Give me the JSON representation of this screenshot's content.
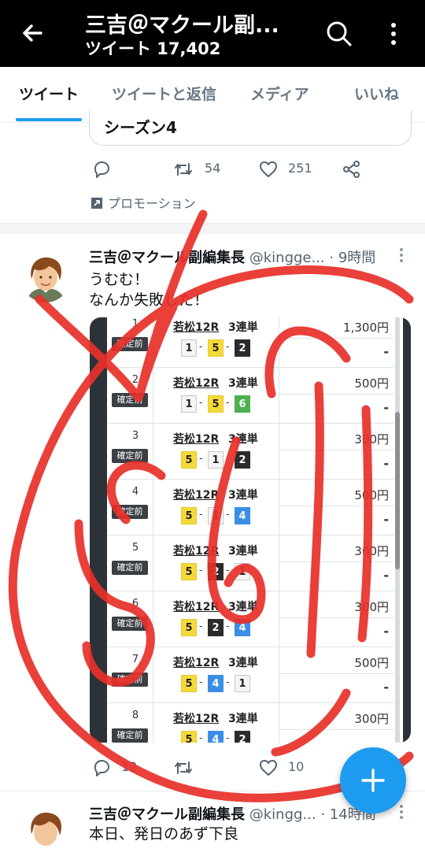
{
  "header": {
    "title": "三吉＠マクール副...",
    "subtitle": "ツイート 17,402"
  },
  "tabs": [
    {
      "label": "ツイート",
      "active": true
    },
    {
      "label": "ツイートと返信",
      "active": false
    },
    {
      "label": "メディア",
      "active": false
    },
    {
      "label": "いいね",
      "active": false
    }
  ],
  "prev_tweet": {
    "card_text": "シーズン4",
    "retweets": "54",
    "likes": "251",
    "promotion": "プロモーション"
  },
  "tweet": {
    "name": "三吉＠マクール副編集長",
    "handle": "@kingge...",
    "time": "· 9時間",
    "line1": "うむむ！",
    "line2": "なんか失敗した！",
    "replies": "12",
    "likes_partial": "10"
  },
  "ticket_rows": [
    {
      "no": "1",
      "status": "確定前",
      "race": "若松12R",
      "kind": "3連単",
      "combo": [
        "1",
        "5",
        "2"
      ],
      "amount": "1,300円",
      "payout": "-"
    },
    {
      "no": "2",
      "status": "確定前",
      "race": "若松12R",
      "kind": "3連単",
      "combo": [
        "1",
        "5",
        "6"
      ],
      "amount": "500円",
      "payout": "-"
    },
    {
      "no": "3",
      "status": "確定前",
      "race": "若松12R",
      "kind": "3連単",
      "combo": [
        "5",
        "1",
        "2"
      ],
      "amount": "300円",
      "payout": "-"
    },
    {
      "no": "4",
      "status": "確定前",
      "race": "若松12R",
      "kind": "3連単",
      "combo": [
        "5",
        "1",
        "4"
      ],
      "amount": "500円",
      "payout": "-"
    },
    {
      "no": "5",
      "status": "確定前",
      "race": "若松12R",
      "kind": "3連単",
      "combo": [
        "5",
        "2",
        "1"
      ],
      "amount": "300円",
      "payout": "-"
    },
    {
      "no": "6",
      "status": "確定前",
      "race": "若松12R",
      "kind": "3連単",
      "combo": [
        "5",
        "2",
        "4"
      ],
      "amount": "300円",
      "payout": "-"
    },
    {
      "no": "7",
      "status": "確定前",
      "race": "若松12R",
      "kind": "3連単",
      "combo": [
        "5",
        "4",
        "1"
      ],
      "amount": "500円",
      "payout": "-"
    },
    {
      "no": "8",
      "status": "確定前",
      "race": "若松12R",
      "kind": "3連単",
      "combo": [
        "5",
        "4",
        "2"
      ],
      "amount": "300円",
      "payout": "-"
    }
  ],
  "next_tweet": {
    "name": "三吉＠マクール副編集長",
    "handle": "@kingg...",
    "time": "· 14時間",
    "text": "本日、発日のあず下良"
  },
  "icons": [
    "back-arrow-icon",
    "search-icon",
    "more-vertical-icon",
    "reply-icon",
    "retweet-icon",
    "like-icon",
    "share-icon",
    "promoted-icon",
    "compose-plus-icon"
  ],
  "colors": {
    "accent": "#1d9bf0",
    "scribble": "#e8302a",
    "boat_1": "#f4f4f4",
    "boat_2": "#2b2b2b",
    "boat_4": "#3a8ee6",
    "boat_5": "#f4d93a",
    "boat_6": "#4caf50"
  }
}
